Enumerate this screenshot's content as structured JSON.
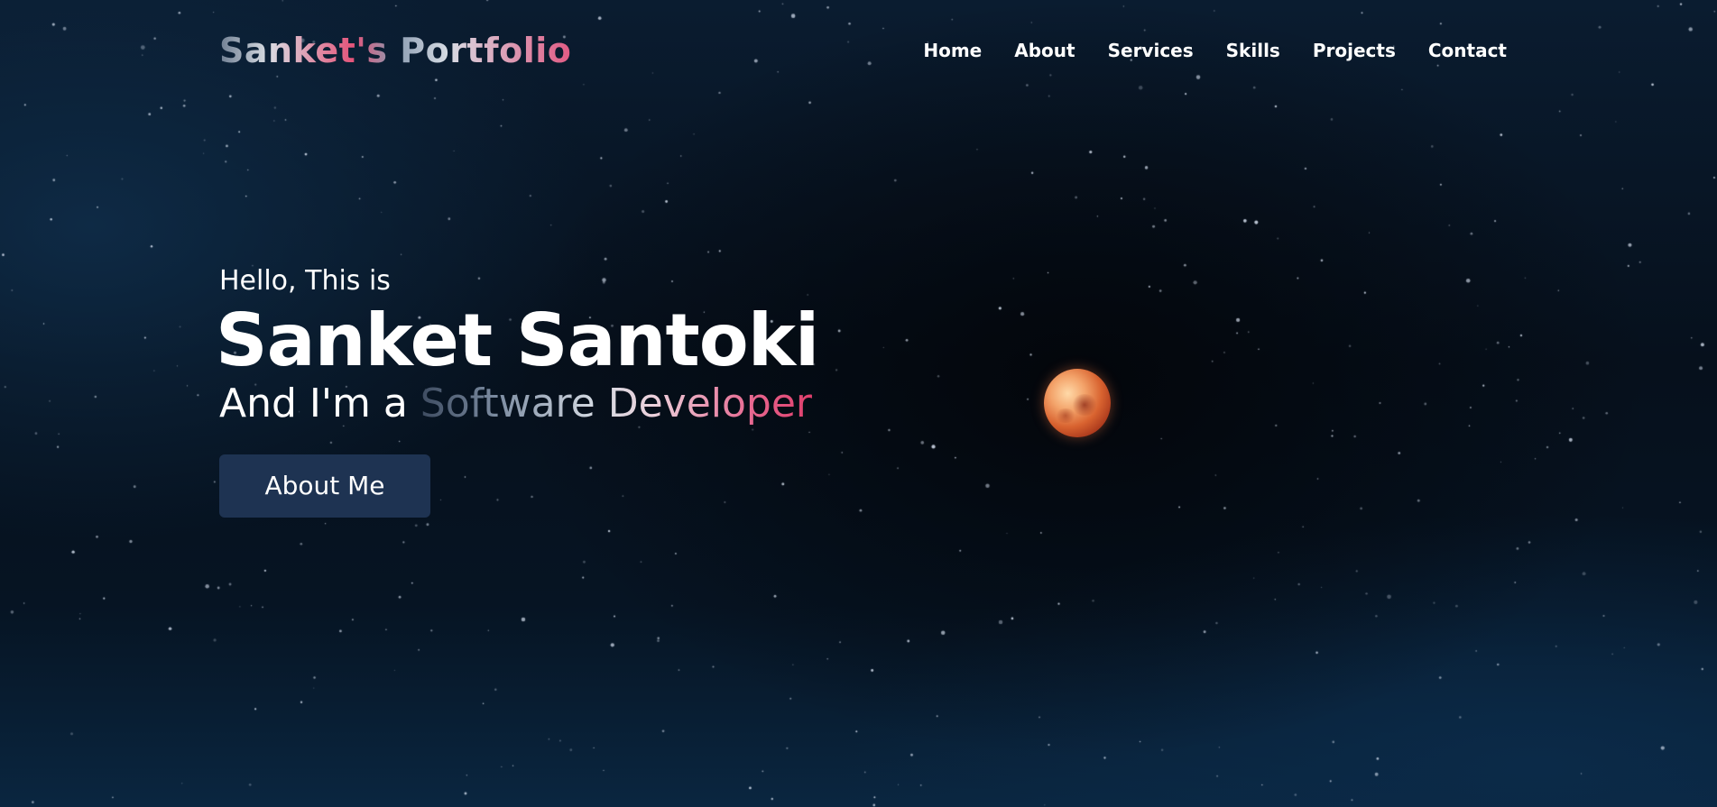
{
  "header": {
    "logo_text": "Sanket's Portfolio",
    "nav_items": [
      {
        "label": "Home"
      },
      {
        "label": "About"
      },
      {
        "label": "Services"
      },
      {
        "label": "Skills"
      },
      {
        "label": "Projects"
      },
      {
        "label": "Contact"
      }
    ]
  },
  "hero": {
    "greeting": "Hello, This is",
    "name": "Sanket Santoki",
    "role_prefix": "And I'm a ",
    "role": "Software Developer",
    "cta_label": "About Me"
  },
  "colors": {
    "button_bg": "#1e3352",
    "accent_pink": "#e4547a",
    "text": "#ffffff",
    "background": "#06101c",
    "moon": "#d8622f"
  }
}
